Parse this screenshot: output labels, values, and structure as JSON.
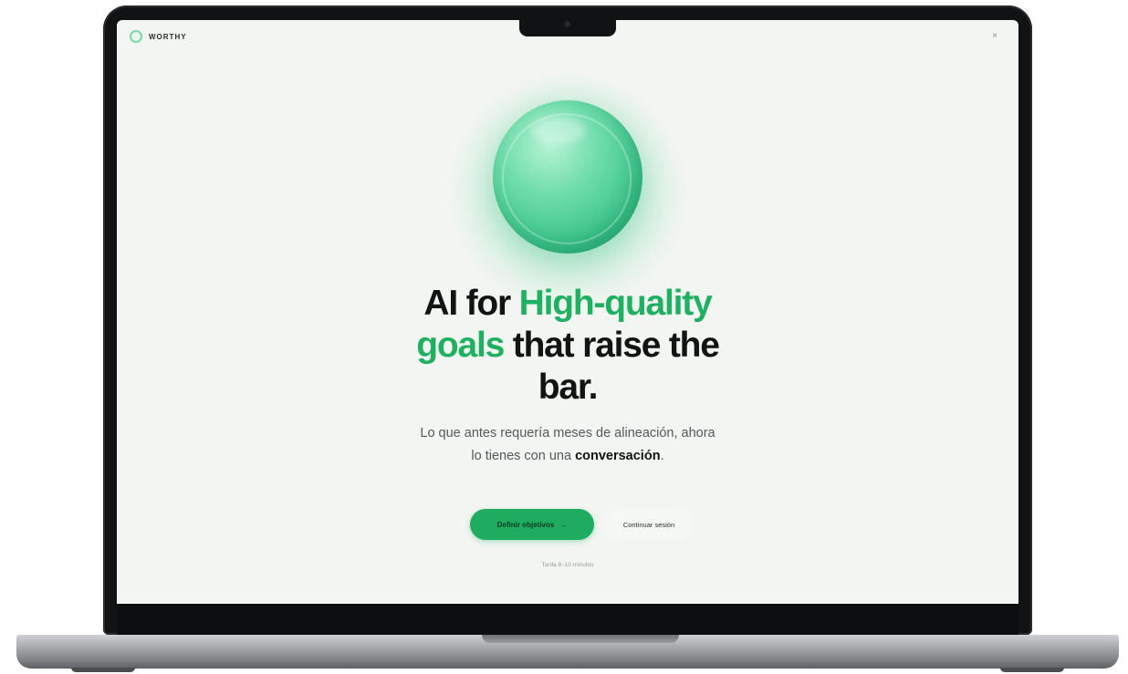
{
  "app": {
    "brand": "WORTHY",
    "close_glyph": "×"
  },
  "hero": {
    "headline_line1_plain": "AI for ",
    "headline_line1_accent": "High-quality",
    "headline_line2_accent": "goals",
    "headline_line2_plain": " that raise the",
    "headline_line3_plain": "bar.",
    "subtitle_line1": "Lo que antes requería meses de alineación, ahora",
    "subtitle_line2_plain": "lo tienes con una ",
    "subtitle_line2_bold": "conversación",
    "subtitle_line2_end": "."
  },
  "actions": {
    "primary_label": "Definir objetivos",
    "primary_arrow": "→",
    "secondary_label": "Continuar sesión",
    "footnote": "Tarda 8–10 minutos"
  },
  "colors": {
    "accent": "#1fb062",
    "primary_button": "#1fac61",
    "screen_background": "#f2f5f1",
    "text_dark": "#121413"
  },
  "icons": {
    "logo": "ring-logo-icon",
    "close": "close-icon",
    "orb": "green-orb-icon",
    "arrow": "arrow-right-icon"
  }
}
